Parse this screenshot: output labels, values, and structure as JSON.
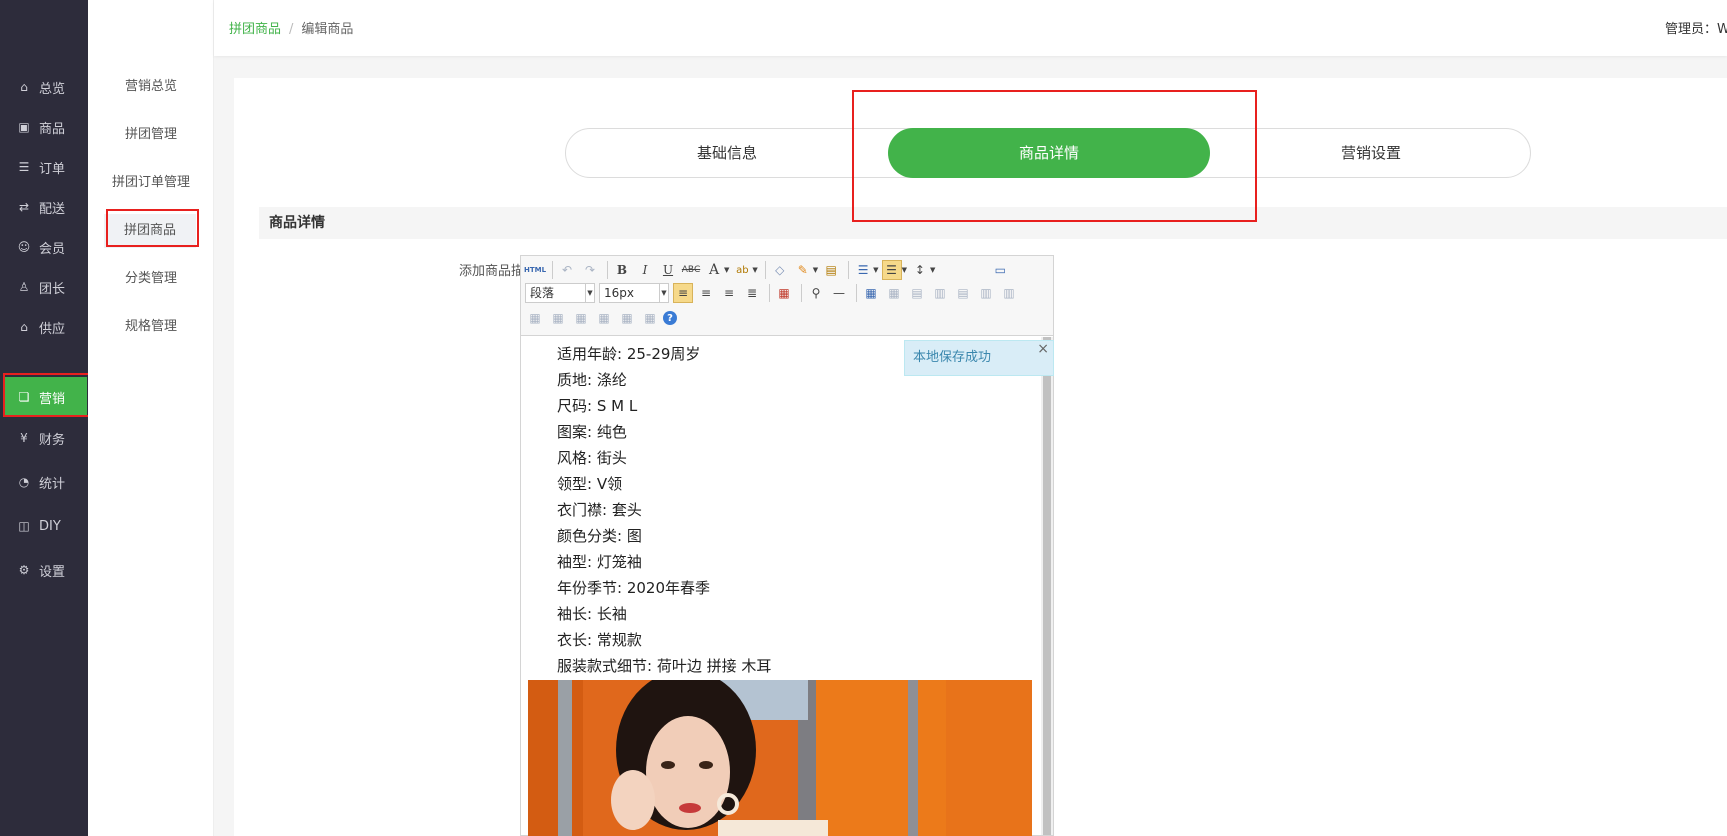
{
  "sidebar": {
    "items": [
      {
        "label": "总览",
        "icon": "home-icon",
        "glyph": "⌂"
      },
      {
        "label": "商品",
        "icon": "goods-icon",
        "glyph": "▣"
      },
      {
        "label": "订单",
        "icon": "order-icon",
        "glyph": "☰"
      },
      {
        "label": "配送",
        "icon": "delivery-icon",
        "glyph": "⇄"
      },
      {
        "label": "会员",
        "icon": "member-icon",
        "glyph": "☺"
      },
      {
        "label": "团长",
        "icon": "leader-icon",
        "glyph": "♙"
      },
      {
        "label": "供应",
        "icon": "supply-icon",
        "glyph": "⌂"
      },
      {
        "label": "营销",
        "icon": "gift-icon",
        "glyph": "❏"
      },
      {
        "label": "财务",
        "icon": "finance-icon",
        "glyph": "¥"
      },
      {
        "label": "统计",
        "icon": "stats-icon",
        "glyph": "◔"
      },
      {
        "label": "DIY",
        "icon": "diy-icon",
        "glyph": "◫"
      },
      {
        "label": "设置",
        "icon": "settings-icon",
        "glyph": "⚙"
      }
    ],
    "active": "营销"
  },
  "subnav": {
    "items": [
      "营销总览",
      "拼团管理",
      "拼团订单管理",
      "拼团商品",
      "分类管理",
      "规格管理"
    ],
    "active": "拼团商品"
  },
  "header": {
    "breadcrumb_link": "拼团商品",
    "breadcrumb_sep": "/",
    "breadcrumb_current": "编辑商品",
    "admin_label": "管理员：W"
  },
  "steps": [
    "基础信息",
    "商品详情",
    "营销设置"
  ],
  "active_step": "商品详情",
  "section_title": "商品详情",
  "field_label": "添加商品描述：",
  "editor": {
    "html_button": "HTML",
    "paragraph_select": "段落",
    "font_size_select": "16px",
    "lines": [
      "适用年龄: 25-29周岁",
      "质地: 涤纶",
      "尺码: S M L",
      "图案: 纯色",
      "风格: 街头",
      "领型: V领",
      "衣门襟: 套头",
      "颜色分类: 图",
      "袖型: 灯笼袖",
      "年份季节: 2020年春季",
      "袖长: 长袖",
      "衣长: 常规款",
      "服装款式细节: 荷叶边 拼接 木耳"
    ]
  },
  "toast": {
    "message": "本地保存成功",
    "close": "×"
  },
  "colors": {
    "accent": "#42b34a",
    "sidebar_bg": "#2d2c3b",
    "highlight_box": "#e8201e"
  }
}
